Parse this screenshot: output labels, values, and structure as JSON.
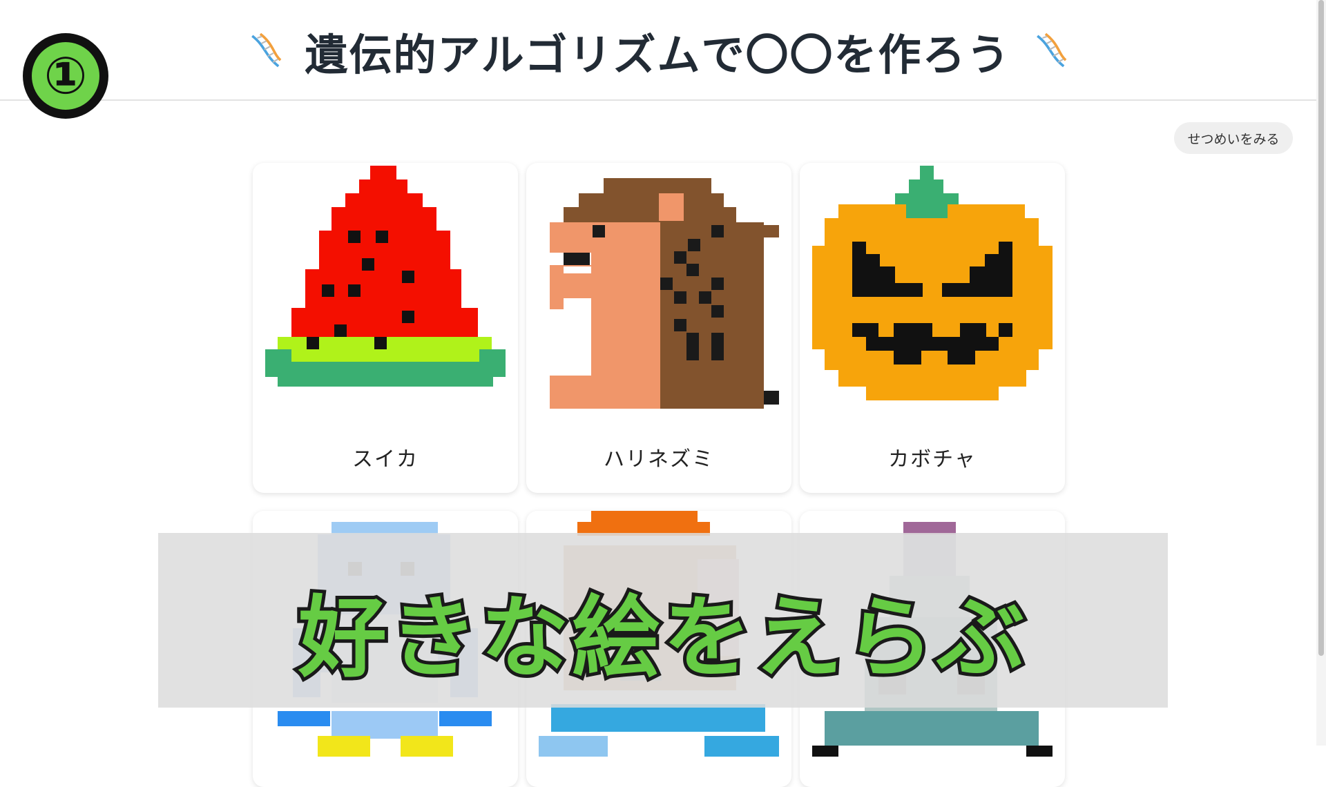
{
  "header": {
    "title": "遺伝的アルゴリズムで〇〇を作ろう"
  },
  "step_badge": "①",
  "explain_button": "せつめいをみる",
  "cards": [
    {
      "label": "スイカ",
      "icon": "watermelon-pixel-art"
    },
    {
      "label": "ハリネズミ",
      "icon": "hedgehog-pixel-art"
    },
    {
      "label": "カボチャ",
      "icon": "pumpkin-pixel-art"
    },
    {
      "label": "",
      "icon": "penguin-pixel-art"
    },
    {
      "label": "",
      "icon": "person-pixel-art"
    },
    {
      "label": "",
      "icon": "bottle-pixel-art"
    }
  ],
  "caption": "好きな絵をえらぶ",
  "colors": {
    "accent_green": "#66cc44",
    "watermelon_red": "#f40f00",
    "pumpkin_orange": "#f7a40b",
    "leaf_green": "#3aaf72"
  }
}
